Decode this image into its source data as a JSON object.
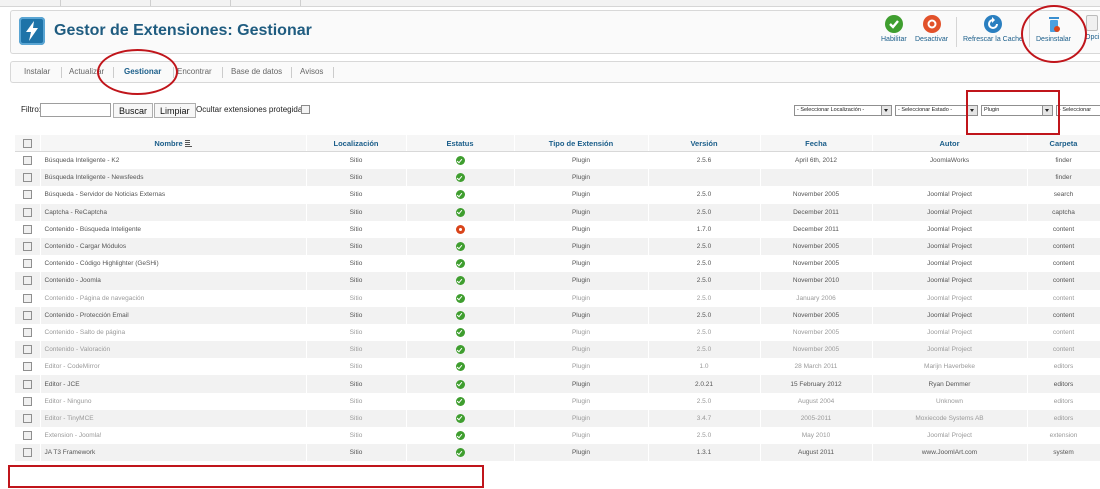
{
  "header": {
    "title": "Gestor de Extensiones: Gestionar"
  },
  "toolbar": {
    "enable_label": "Habilitar",
    "disable_label": "Desactivar",
    "refresh_label": "Refrescar la Cache",
    "uninstall_label": "Desinstalar",
    "options_label": "Opci"
  },
  "tabs": [
    {
      "label": "Instalar"
    },
    {
      "label": "Actualizar"
    },
    {
      "label": "Gestionar"
    },
    {
      "label": "Encontrar"
    },
    {
      "label": "Base de datos"
    },
    {
      "label": "Avisos"
    }
  ],
  "filter": {
    "label": "Filtro:",
    "value": "",
    "search_button": "Buscar",
    "clear_button": "Limpiar",
    "hide_protected_label": "Ocultar extensiones protegidas",
    "location_select": "- Seleccionar Localización -",
    "status_select": "- Seleccionar Estado -",
    "type_select": "Plugin",
    "folder_select": "- Seleccionar"
  },
  "table": {
    "columns": [
      "Nombre",
      "Localización",
      "Estatus",
      "Tipo de Extensión",
      "Versión",
      "Fecha",
      "Autor",
      "Carpeta"
    ],
    "rows": [
      {
        "name": "Búsqueda Inteligente - K2",
        "location": "Sitio",
        "status": "enabled",
        "type": "Plugin",
        "version": "2.5.6",
        "date": "April 6th, 2012",
        "author": "JoomlaWorks",
        "folder": "finder",
        "dim": false
      },
      {
        "name": "Búsqueda Inteligente - Newsfeeds",
        "location": "Sitio",
        "status": "enabled",
        "type": "Plugin",
        "version": "",
        "date": "",
        "author": "",
        "folder": "finder",
        "dim": false
      },
      {
        "name": "Búsqueda - Servidor de Noticias Externas",
        "location": "Sitio",
        "status": "enabled",
        "type": "Plugin",
        "version": "2.5.0",
        "date": "November 2005",
        "author": "Joomla! Project",
        "folder": "search",
        "dim": false
      },
      {
        "name": "Captcha - ReCaptcha",
        "location": "Sitio",
        "status": "enabled",
        "type": "Plugin",
        "version": "2.5.0",
        "date": "December 2011",
        "author": "Joomla! Project",
        "folder": "captcha",
        "dim": false
      },
      {
        "name": "Contenido - Búsqueda Inteligente",
        "location": "Sitio",
        "status": "disabled",
        "type": "Plugin",
        "version": "1.7.0",
        "date": "December 2011",
        "author": "Joomla! Project",
        "folder": "content",
        "dim": false
      },
      {
        "name": "Contenido - Cargar Módulos",
        "location": "Sitio",
        "status": "enabled",
        "type": "Plugin",
        "version": "2.5.0",
        "date": "November 2005",
        "author": "Joomla! Project",
        "folder": "content",
        "dim": false
      },
      {
        "name": "Contenido - Código Highlighter (GeSHi)",
        "location": "Sitio",
        "status": "enabled",
        "type": "Plugin",
        "version": "2.5.0",
        "date": "November 2005",
        "author": "Joomla! Project",
        "folder": "content",
        "dim": false
      },
      {
        "name": "Contenido - Joomla",
        "location": "Sitio",
        "status": "enabled",
        "type": "Plugin",
        "version": "2.5.0",
        "date": "November 2010",
        "author": "Joomla! Project",
        "folder": "content",
        "dim": false
      },
      {
        "name": "Contenido - Página de navegación",
        "location": "Sitio",
        "status": "enabled",
        "type": "Plugin",
        "version": "2.5.0",
        "date": "January 2006",
        "author": "Joomla! Project",
        "folder": "content",
        "dim": true
      },
      {
        "name": "Contenido - Protección Email",
        "location": "Sitio",
        "status": "enabled",
        "type": "Plugin",
        "version": "2.5.0",
        "date": "November 2005",
        "author": "Joomla! Project",
        "folder": "content",
        "dim": false
      },
      {
        "name": "Contenido - Salto de página",
        "location": "Sitio",
        "status": "enabled",
        "type": "Plugin",
        "version": "2.5.0",
        "date": "November 2005",
        "author": "Joomla! Project",
        "folder": "content",
        "dim": true
      },
      {
        "name": "Contenido - Valoración",
        "location": "Sitio",
        "status": "enabled",
        "type": "Plugin",
        "version": "2.5.0",
        "date": "November 2005",
        "author": "Joomla! Project",
        "folder": "content",
        "dim": true
      },
      {
        "name": "Editor - CodeMirror",
        "location": "Sitio",
        "status": "enabled",
        "type": "Plugin",
        "version": "1.0",
        "date": "28 March 2011",
        "author": "Marijn Haverbeke",
        "folder": "editors",
        "dim": true
      },
      {
        "name": "Editor - JCE",
        "location": "Sitio",
        "status": "enabled",
        "type": "Plugin",
        "version": "2.0.21",
        "date": "15 February 2012",
        "author": "Ryan Demmer",
        "folder": "editors",
        "dim": false
      },
      {
        "name": "Editor - Ninguno",
        "location": "Sitio",
        "status": "enabled",
        "type": "Plugin",
        "version": "2.5.0",
        "date": "August 2004",
        "author": "Unknown",
        "folder": "editors",
        "dim": true
      },
      {
        "name": "Editor - TinyMCE",
        "location": "Sitio",
        "status": "enabled",
        "type": "Plugin",
        "version": "3.4.7",
        "date": "2005-2011",
        "author": "Moxiecode Systems AB",
        "folder": "editors",
        "dim": true
      },
      {
        "name": "Extension - Joomla!",
        "location": "Sitio",
        "status": "enabled",
        "type": "Plugin",
        "version": "2.5.0",
        "date": "May 2010",
        "author": "Joomla! Project",
        "folder": "extension",
        "dim": true
      },
      {
        "name": "JA T3 Framework",
        "location": "Sitio",
        "status": "enabled",
        "type": "Plugin",
        "version": "1.3.1",
        "date": "August 2011",
        "author": "www.JoomlArt.com",
        "folder": "system",
        "dim": false
      }
    ]
  },
  "colors": {
    "accent": "#1b5e8a",
    "enabled": "#3f9e2f",
    "disabled": "#d9441a",
    "annotation": "#c0151b"
  }
}
